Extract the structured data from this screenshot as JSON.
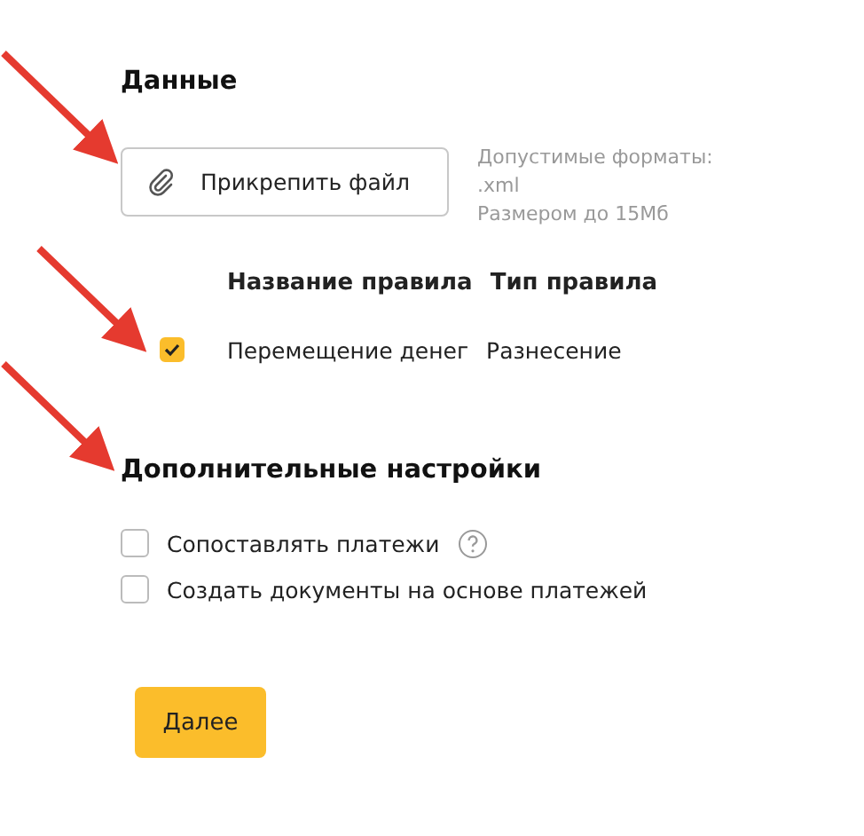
{
  "data_section": {
    "title": "Данные",
    "attach_button": {
      "label": "Прикрепить файл"
    },
    "hint_lines": [
      "Допустимые форматы:",
      ".xml",
      "Размером до 15Мб"
    ]
  },
  "rules_table": {
    "columns": [
      "Название правила",
      "Тип правила"
    ],
    "rows": [
      {
        "checked": true,
        "name": "Перемещение денег",
        "type": "Разнесение"
      }
    ]
  },
  "extra_settings": {
    "title": "Дополнительные настройки",
    "options": [
      {
        "label": "Сопоставлять платежи",
        "checked": false,
        "help": true
      },
      {
        "label": "Создать документы на основе платежей",
        "checked": false,
        "help": false
      }
    ]
  },
  "next_button": {
    "label": "Далее"
  }
}
